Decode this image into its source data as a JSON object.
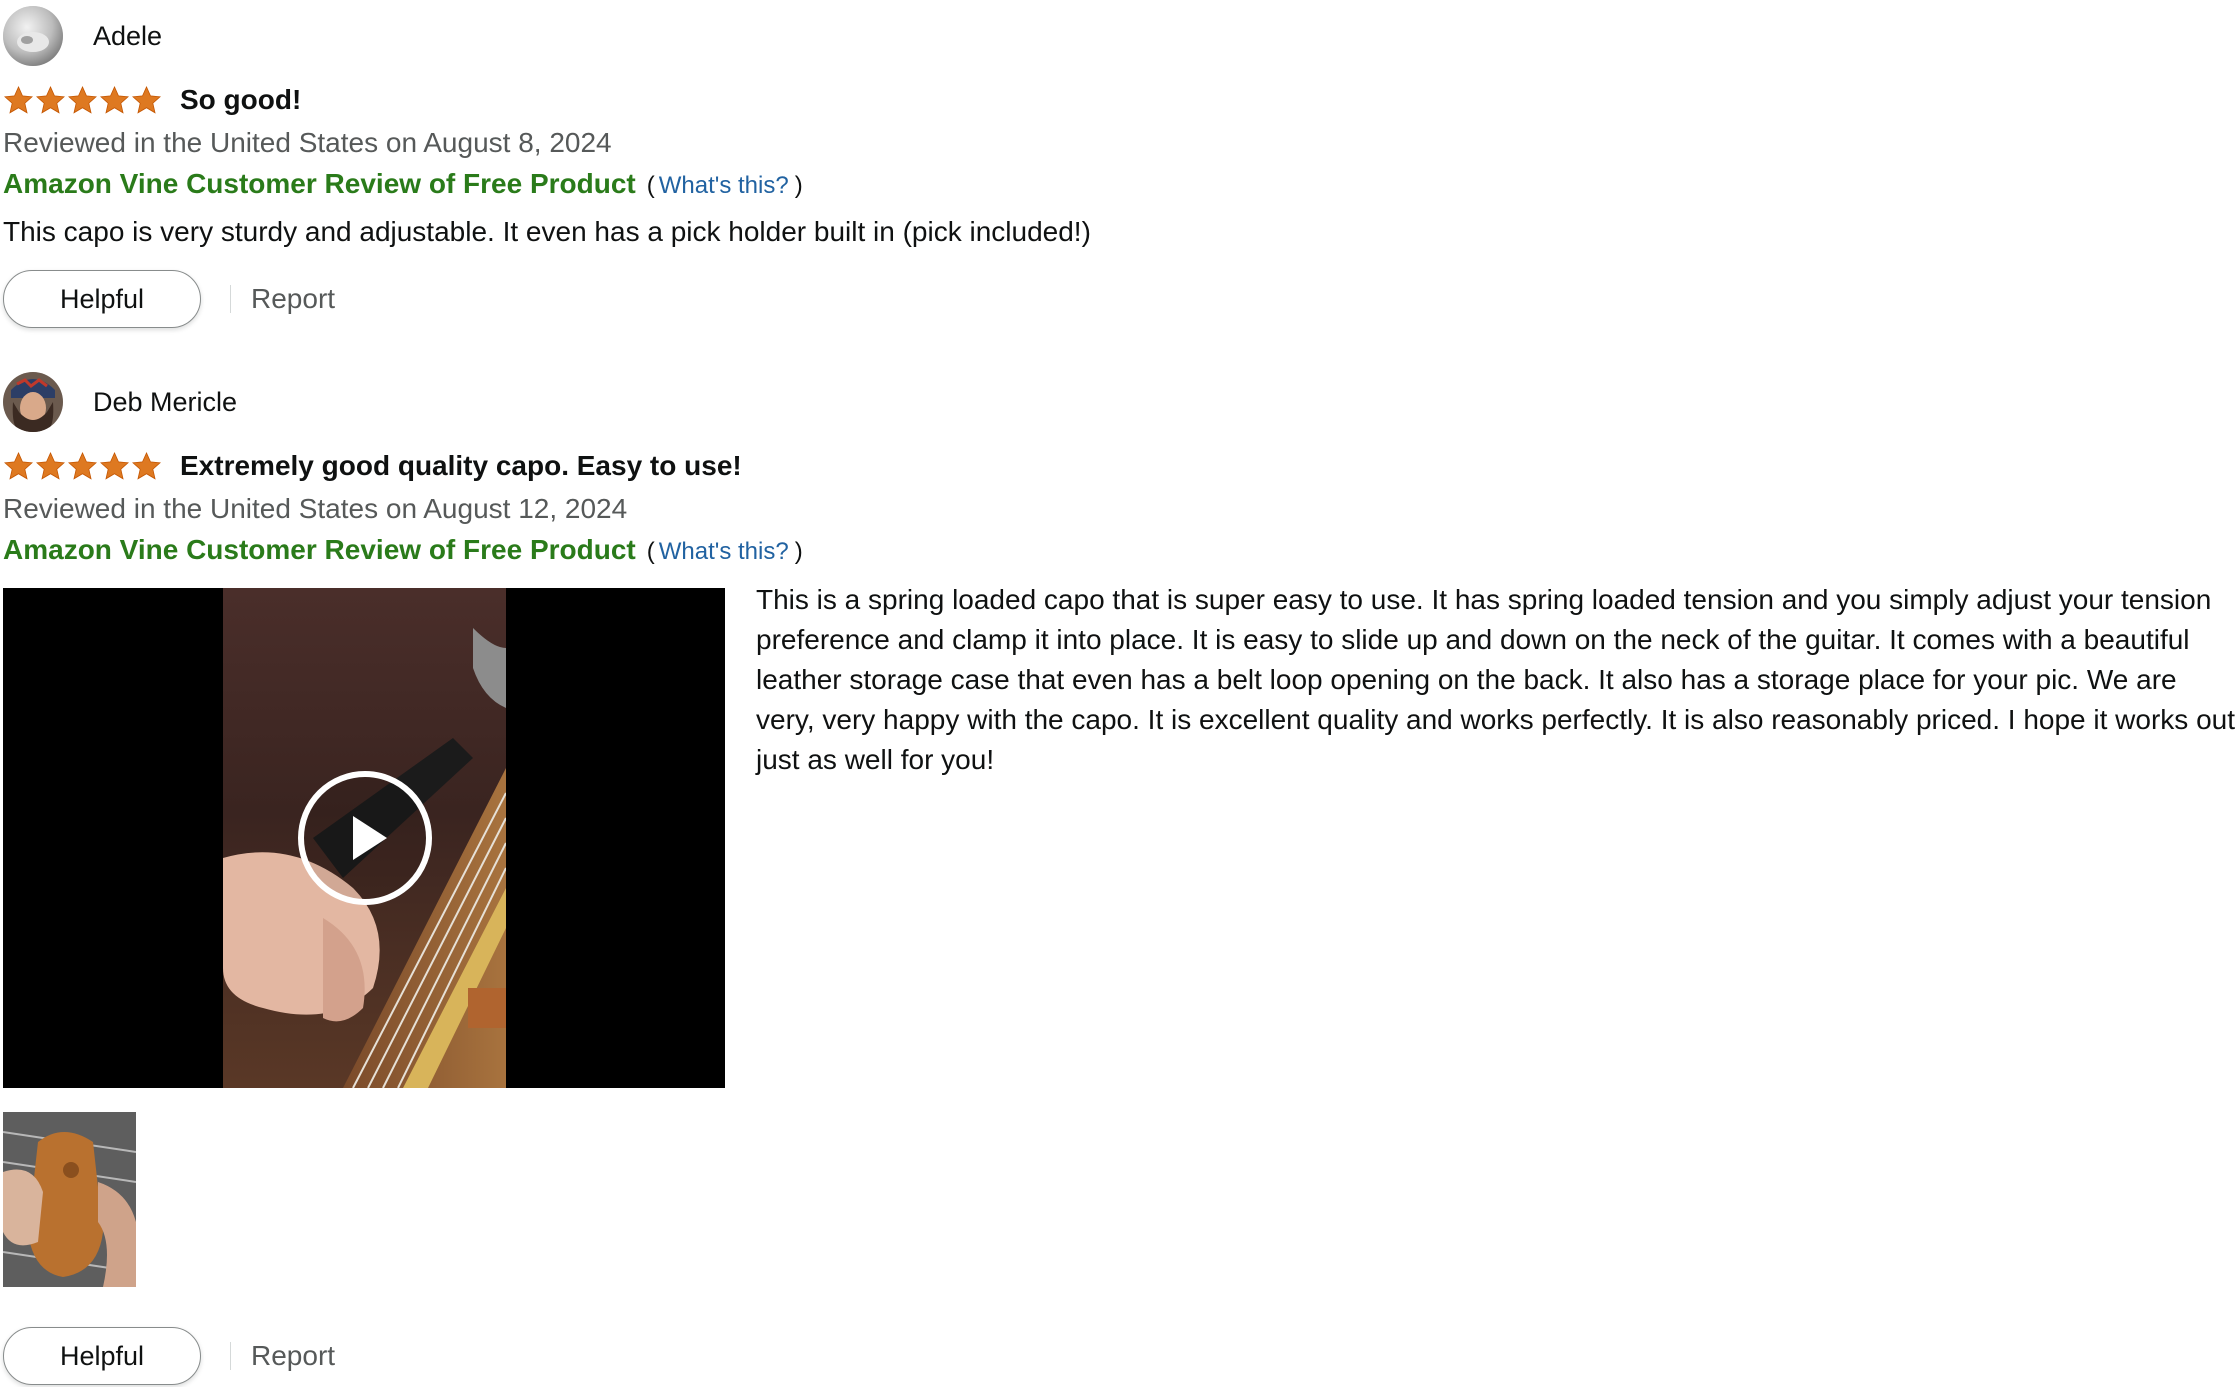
{
  "reviews": [
    {
      "profile_name": "Adele",
      "rating": 5,
      "title": "So good!",
      "date_line": "Reviewed in the United States on August 8, 2024",
      "vine_badge": "Amazon Vine Customer Review of Free Product",
      "paren_open": "(",
      "whats_this": "What's this?",
      "paren_close": ")",
      "body": "This capo is very sturdy and adjustable. It even has a pick holder built in (pick included!)",
      "helpful_label": "Helpful",
      "report_label": "Report"
    },
    {
      "profile_name": "Deb Mericle",
      "rating": 5,
      "title": "Extremely good quality capo. Easy to use!",
      "date_line": "Reviewed in the United States on August 12, 2024",
      "vine_badge": "Amazon Vine Customer Review of Free Product",
      "paren_open": "(",
      "whats_this": "What's this?",
      "paren_close": ")",
      "body": "This is a spring loaded capo that is super easy to use. It has spring loaded tension and you simply adjust your tension preference and clamp it into place. It is easy to slide up and down on the neck of the guitar. It comes with a beautiful leather storage case that even has a belt loop opening on the back. It also has a storage place for your pic. We are very, very happy with the capo. It is excellent quality and works perfectly. It is also reasonably priced. I hope it works out just as well for you!",
      "helpful_label": "Helpful",
      "report_label": "Report"
    }
  ],
  "icons": {
    "star": "star-icon",
    "play": "play-icon"
  },
  "colors": {
    "star": "#de7921",
    "vine_badge": "#2a7b1a",
    "link": "#2162a1",
    "muted_text": "#565959"
  }
}
